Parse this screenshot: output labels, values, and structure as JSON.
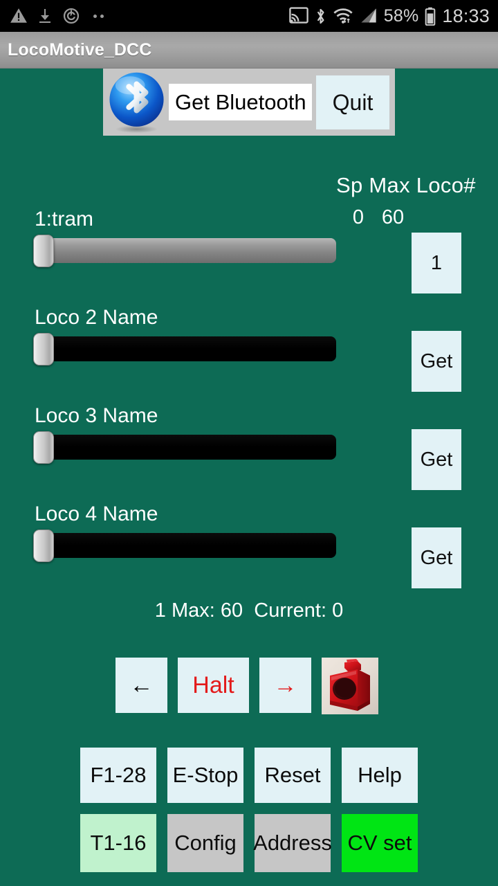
{
  "status_bar": {
    "icons_left": [
      "warning-triangle-icon",
      "download-icon",
      "power-timer-icon",
      "more-dots-icon"
    ],
    "icons_right": [
      "cast-icon",
      "bluetooth-icon",
      "wifi-icon",
      "cellular-signal-icon",
      "battery-icon"
    ],
    "battery_percent": "58%",
    "clock": "18:33"
  },
  "title_bar": {
    "title": "LocoMotive_DCC"
  },
  "bluetooth_panel": {
    "logo_icon": "bluetooth-logo-icon",
    "get_bluetooth_label": "Get Bluetooth",
    "quit_label": "Quit"
  },
  "columns": {
    "header": "Sp Max Loco#",
    "sp_value": "0",
    "max_value": "60"
  },
  "locos": [
    {
      "label": "1:tram",
      "slider_enabled": true,
      "slider_value": 0,
      "button_label": "1"
    },
    {
      "label": "Loco 2 Name",
      "slider_enabled": false,
      "slider_value": 0,
      "button_label": "Get"
    },
    {
      "label": "Loco 3 Name",
      "slider_enabled": false,
      "slider_value": 0,
      "button_label": "Get"
    },
    {
      "label": "Loco 4 Name",
      "slider_enabled": false,
      "slider_value": 0,
      "button_label": "Get"
    }
  ],
  "status_line": "1 Max: 60  Current: 0",
  "controls": {
    "reverse_label": "←",
    "halt_label": "Halt",
    "forward_label": "→",
    "photo_icon": "red-tram-body-photo"
  },
  "function_row_1": [
    {
      "label": "F1-28",
      "style": "default"
    },
    {
      "label": "E-Stop",
      "style": "default"
    },
    {
      "label": "Reset",
      "style": "default"
    },
    {
      "label": "Help",
      "style": "default"
    }
  ],
  "function_row_2": [
    {
      "label": "T1-16",
      "style": "lightgreen"
    },
    {
      "label": "Config",
      "style": "grey"
    },
    {
      "label": "Address",
      "style": "grey"
    },
    {
      "label": "CV set",
      "style": "green"
    }
  ],
  "colors": {
    "background": "#0d6b55",
    "button_default": "#e2f2f6",
    "button_lightgreen": "#c0f2cd",
    "button_grey": "#c6c6c6",
    "button_green": "#00e514",
    "halt_red": "#e31b1b",
    "title_bar": "#a0a0a0"
  }
}
